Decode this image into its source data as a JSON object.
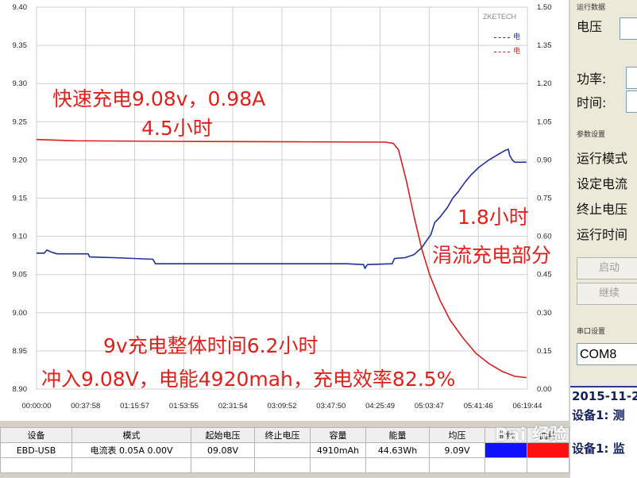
{
  "brand": "ZKETECH",
  "legend": [
    {
      "name": "电",
      "color": "#1f2f9e"
    },
    {
      "name": "电",
      "color": "#d62020"
    }
  ],
  "colors": {
    "voltage": "#1f2f9e",
    "current": "#d62020",
    "annotation": "#e0211b"
  },
  "annotations": {
    "fast_charge": "快速充电9.08v，0.98A",
    "fast_time": "4.5小时",
    "trickle_time": "1.8小时",
    "trickle_label": "涓流充电部分",
    "total_time": "9v充电整体时间6.2小时",
    "summary": "冲入9.08V，电能4920mah，充电效率82.5%"
  },
  "chart_data": {
    "type": "line",
    "title": "",
    "x_ticks": [
      "00:00:00",
      "00:37:58",
      "01:15:57",
      "01:53:55",
      "02:31:54",
      "03:09:52",
      "03:47:50",
      "04:25:49",
      "05:03:47",
      "05:41:46",
      "06:19:44"
    ],
    "y_left": {
      "ticks": [
        "9.40",
        "9.35",
        "9.30",
        "9.25",
        "9.20",
        "9.15",
        "9.10",
        "9.05",
        "9.00",
        "8.95",
        "8.90"
      ],
      "range": [
        8.9,
        9.4
      ]
    },
    "y_right": {
      "ticks": [
        "1.50",
        "1.35",
        "1.20",
        "1.05",
        "0.90",
        "0.75",
        "0.60",
        "0.45",
        "0.30",
        "0.15",
        "0.00"
      ],
      "range": [
        0.0,
        1.5
      ]
    },
    "x_range_minutes": [
      0,
      379.73
    ],
    "grid": true,
    "series": [
      {
        "axis": "left",
        "color": "#1f2f9e",
        "points": [
          [
            0,
            9.078
          ],
          [
            6,
            9.078
          ],
          [
            8,
            9.082
          ],
          [
            12,
            9.079
          ],
          [
            16,
            9.077
          ],
          [
            40,
            9.077
          ],
          [
            41,
            9.073
          ],
          [
            60,
            9.072
          ],
          [
            90,
            9.07
          ],
          [
            92,
            9.064
          ],
          [
            150,
            9.064
          ],
          [
            200,
            9.064
          ],
          [
            240,
            9.064
          ],
          [
            253,
            9.063
          ],
          [
            254,
            9.058
          ],
          [
            256,
            9.063
          ],
          [
            275,
            9.064
          ],
          [
            277,
            9.071
          ],
          [
            285,
            9.072
          ],
          [
            292,
            9.076
          ],
          [
            298,
            9.085
          ],
          [
            302,
            9.095
          ],
          [
            305,
            9.102
          ],
          [
            308,
            9.118
          ],
          [
            312,
            9.125
          ],
          [
            318,
            9.138
          ],
          [
            322,
            9.15
          ],
          [
            326,
            9.158
          ],
          [
            332,
            9.172
          ],
          [
            336,
            9.18
          ],
          [
            342,
            9.19
          ],
          [
            350,
            9.2
          ],
          [
            356,
            9.206
          ],
          [
            362,
            9.212
          ],
          [
            365,
            9.214
          ],
          [
            366,
            9.206
          ],
          [
            368,
            9.2
          ],
          [
            370,
            9.197
          ],
          [
            374,
            9.197
          ],
          [
            379,
            9.197
          ]
        ]
      },
      {
        "axis": "right",
        "color": "#d62020",
        "points": [
          [
            0,
            0.98
          ],
          [
            30,
            0.975
          ],
          [
            100,
            0.973
          ],
          [
            200,
            0.971
          ],
          [
            270,
            0.97
          ],
          [
            276,
            0.965
          ],
          [
            280,
            0.94
          ],
          [
            286,
            0.82
          ],
          [
            292,
            0.68
          ],
          [
            298,
            0.55
          ],
          [
            304,
            0.45
          ],
          [
            312,
            0.35
          ],
          [
            320,
            0.27
          ],
          [
            330,
            0.2
          ],
          [
            340,
            0.14
          ],
          [
            350,
            0.1
          ],
          [
            360,
            0.07
          ],
          [
            370,
            0.05
          ],
          [
            379,
            0.045
          ]
        ]
      }
    ]
  },
  "right_panel": {
    "run_group": "运行数据",
    "voltage": "电压",
    "power": "功率:",
    "time": "时间:",
    "settings_group": "参数设置",
    "run_mode": "运行模式",
    "set_current": "设定电流",
    "stop_voltage": "终止电压",
    "run_time": "运行时间",
    "start_button": "启动",
    "continue_button": "继续",
    "serial_group": "串口设置",
    "com_port": "COM8",
    "log_date": "2015-11-2",
    "log_line1": "设备1: 测",
    "log_line2": "设备1: 监"
  },
  "table": {
    "headers": [
      "设备",
      "模式",
      "起始电压",
      "终止电压",
      "容量",
      "能量",
      "均压",
      "曲线",
      "曲线"
    ],
    "row": [
      "EBD-USB",
      "电流表 0.05A  0.00V",
      "09.08V",
      "",
      "4910mAh",
      "44.63Wh",
      "9.09V",
      "",
      ""
    ],
    "swatch_colors": [
      "#1010ff",
      "#ff1010"
    ]
  },
  "watermark": "Bai 经验"
}
